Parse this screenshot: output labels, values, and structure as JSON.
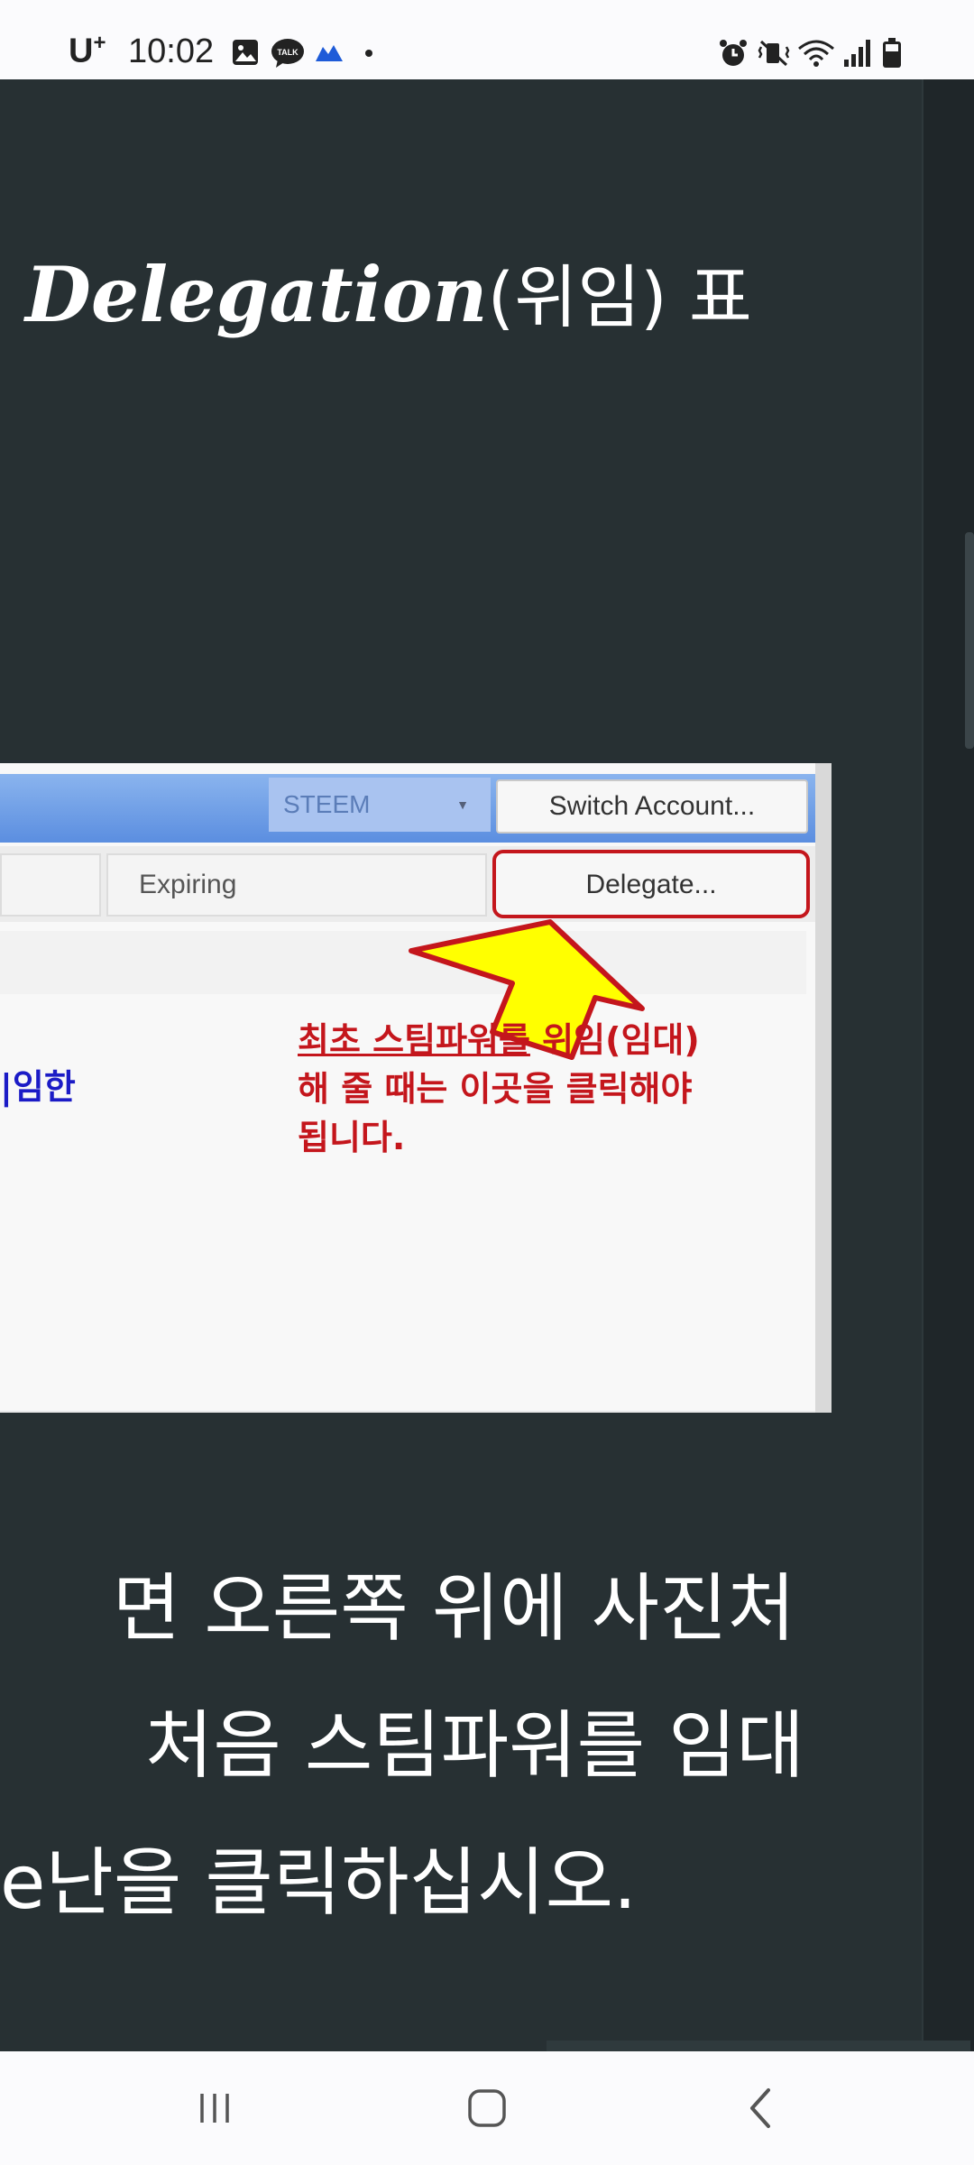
{
  "status_bar": {
    "carrier": "U",
    "carrier_sup": "+",
    "time": "10:02",
    "left_icons": [
      "gallery-icon",
      "kakaotalk-icon",
      "cloud-icon",
      "dot-icon"
    ],
    "right_icons": [
      "alarm-icon",
      "mute-vibrate-icon",
      "wifi-icon",
      "signal-icon",
      "battery-icon"
    ]
  },
  "article": {
    "heading_italic": "Delegation",
    "heading_rest": "(위임) 표",
    "screenshot": {
      "currency_select": "STEEM",
      "switch_account_label": "Switch Account...",
      "expiring_tab_label": "Expiring",
      "delegate_button_label": "Delegate...",
      "blue_text": "|임한",
      "annotation_line1_underlined": "최초 스팀파워를",
      "annotation_line1_rest": " 위임(임대)",
      "annotation_line2": "해 줄 때는 이곳을 클릭해야",
      "annotation_line3": "됩니다.",
      "arrow_color": "#ffff00",
      "annotation_color": "#c4161c"
    },
    "body_lines": [
      "면 오른쪽 위에 사진처",
      "처음 스팀파워를 임대",
      "e난을 클릭하십시오."
    ]
  },
  "nav_bar": {
    "recent_icon": "recent-apps-icon",
    "home_icon": "home-icon",
    "back_icon": "back-icon"
  }
}
